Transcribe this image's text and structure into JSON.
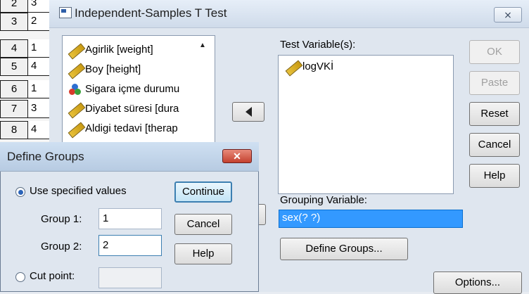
{
  "sheet": {
    "rows": [
      {
        "num": "2",
        "val": "3"
      },
      {
        "num": "3",
        "val": "2"
      },
      {
        "num": "4",
        "val": "1"
      },
      {
        "num": "5",
        "val": "4"
      },
      {
        "num": "6",
        "val": "1"
      },
      {
        "num": "7",
        "val": "3"
      },
      {
        "num": "8",
        "val": "4"
      }
    ]
  },
  "main": {
    "title": "Independent-Samples T Test",
    "close_label": "⨯",
    "variables": [
      {
        "label": "Agirlik [weight]",
        "icon": "ruler-icon"
      },
      {
        "label": "Boy [height]",
        "icon": "ruler-icon"
      },
      {
        "label": "Sigara içme durumu",
        "icon": "nominal-icon"
      },
      {
        "label": "Diyabet süresi [dura",
        "icon": "ruler-icon"
      },
      {
        "label": "Aldigi tedavi [therap",
        "icon": "ruler-icon"
      }
    ],
    "test_variables_label": "Test Variable(s):",
    "test_variables": [
      {
        "label": "logVKİ",
        "icon": "ruler-icon"
      }
    ],
    "grouping_label": "Grouping Variable:",
    "grouping_value": "sex(? ?)",
    "define_groups_label": "Define Groups...",
    "buttons": {
      "ok": "OK",
      "paste": "Paste",
      "reset": "Reset",
      "cancel": "Cancel",
      "help": "Help",
      "options": "Options..."
    }
  },
  "define_groups": {
    "title": "Define Groups",
    "close_label": "✕",
    "use_specified_label": "Use specified values",
    "group1_label": "Group 1:",
    "group1_value": "1",
    "group2_label": "Group 2:",
    "group2_value": "2",
    "cut_point_label": "Cut point:",
    "buttons": {
      "continue": "Continue",
      "cancel": "Cancel",
      "help": "Help"
    }
  }
}
